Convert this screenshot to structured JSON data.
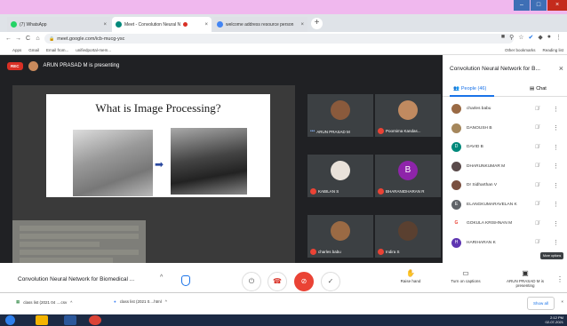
{
  "browser": {
    "tabs": [
      {
        "title": "(7) WhatsApp",
        "favicon_color": "#25d366"
      },
      {
        "title": "Meet - Convolution Neural N",
        "favicon_color": "#00897b"
      },
      {
        "title": "welcome address resource person",
        "favicon_color": "#4285f4"
      }
    ],
    "url": "meet.google.com/icb-mucg-ysc",
    "bookmarks": [
      "Apps",
      "Gmail",
      "Email from...",
      "unifiedportal-mem..."
    ],
    "bookmarks_right": [
      "Other bookmarks",
      "Reading list"
    ]
  },
  "meet": {
    "rec_label": "REC",
    "presenter_text": "ARUN PRASAD M is presenting",
    "slide_title": "What is Image Processing?",
    "tiles": [
      {
        "name": "ARUN PRASAD M",
        "face": "#8a5a3c",
        "muted": false
      },
      {
        "name": "Poornima Kandas...",
        "face": "#c08a60",
        "muted": true
      },
      {
        "name": "KABILAN S",
        "face": "#e9e2da",
        "muted": true
      },
      {
        "name": "BHARANIDHARAN R",
        "face": "#8e24aa",
        "letter": "B",
        "muted": true
      },
      {
        "name": "charles babu",
        "face": "#9a6a44",
        "muted": true
      },
      {
        "name": "Indira S",
        "face": "#5a4030",
        "muted": true
      }
    ],
    "panel": {
      "title": "Convolution Neural Network for B...",
      "people_tab": "People (46)",
      "chat_tab": "Chat",
      "people": [
        {
          "name": "charles babu",
          "color": "#9a6a44",
          "letter": ""
        },
        {
          "name": "DANOUSH B",
          "color": "#a5875c",
          "letter": ""
        },
        {
          "name": "DAVID B",
          "color": "#00897b",
          "letter": "D"
        },
        {
          "name": "DHARUNKUMAR M",
          "color": "#5a4a4a",
          "letter": ""
        },
        {
          "name": "Dr Sidharthan V",
          "color": "#7a5040",
          "letter": ""
        },
        {
          "name": "ELANGKUMARAVELAN K",
          "color": "#5f6368",
          "letter": "E"
        },
        {
          "name": "GOKULA KRISHNAN M",
          "color": "#ffffff",
          "letter": "G"
        },
        {
          "name": "HARIHARAN K",
          "color": "#5e35b1",
          "letter": "H"
        }
      ],
      "more_tooltip": "More options"
    },
    "controls": {
      "meeting_name": "Convolution Neural Network for Biomedical ...",
      "raise_hand": "Raise hand",
      "captions": "Turn on captions",
      "presenting": "ARUN PRASAD M is presenting"
    }
  },
  "downloads": {
    "items": [
      "class list (2021 04 ....csv",
      "class list (2021 0....html"
    ],
    "show_all": "Show all"
  },
  "taskbar": {
    "time": "2:12 PM",
    "date": "02-07-2021"
  }
}
